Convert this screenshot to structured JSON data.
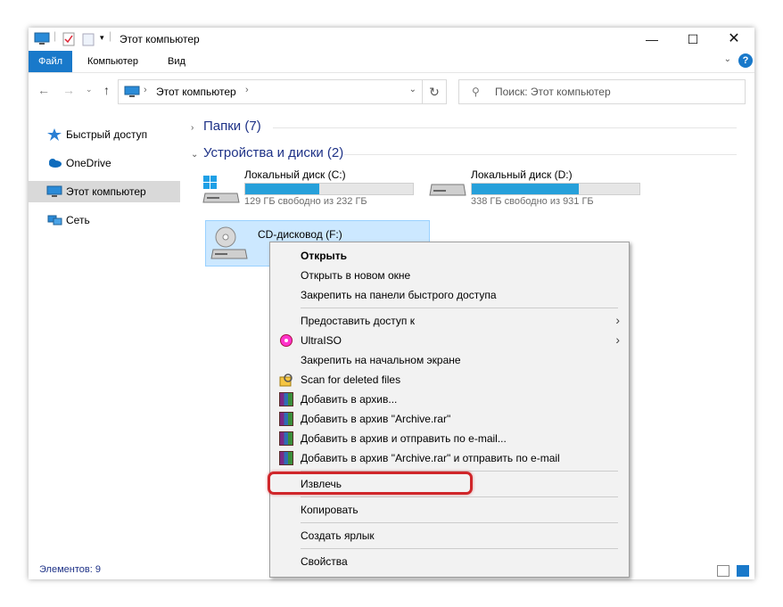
{
  "window": {
    "title": "Этот компьютер"
  },
  "ribbon": {
    "tabs": [
      "Файл",
      "Компьютер",
      "Вид"
    ]
  },
  "address": {
    "location": "Этот компьютер",
    "search_placeholder": "Поиск: Этот компьютер"
  },
  "nav": {
    "items": [
      "Быстрый доступ",
      "OneDrive",
      "Этот компьютер",
      "Сеть"
    ]
  },
  "content": {
    "folders_group": "Папки (7)",
    "devices_group": "Устройства и диски (2)",
    "drives": [
      {
        "name": "Локальный диск (C:)",
        "free": "129 ГБ свободно из 232 ГБ",
        "used_fraction": 0.44
      },
      {
        "name": "Локальный диск (D:)",
        "free": "338 ГБ свободно из 931 ГБ",
        "used_fraction": 0.64
      },
      {
        "name": "CD-дисковод (F:)"
      }
    ]
  },
  "status": {
    "items_count": "Элементов: 9"
  },
  "context_menu": {
    "open": "Открыть",
    "open_new_window": "Открыть в новом окне",
    "pin_quick_access": "Закрепить на панели быстрого доступа",
    "give_access": "Предоставить доступ к",
    "ultraiso": "UltraISO",
    "pin_start": "Закрепить на начальном экране",
    "scan_deleted": "Scan for deleted files",
    "add_archive": "Добавить в архив...",
    "add_archive_rar": "Добавить в архив \"Archive.rar\"",
    "add_archive_email": "Добавить в архив и отправить по e-mail...",
    "add_archive_rar_email": "Добавить в архив \"Archive.rar\" и отправить по e-mail",
    "eject": "Извлечь",
    "copy": "Копировать",
    "create_shortcut": "Создать ярлык",
    "properties": "Свойства"
  },
  "colors": {
    "accent": "#1979ca",
    "drive_bar": "#26a0da",
    "highlight": "#d0262a"
  }
}
